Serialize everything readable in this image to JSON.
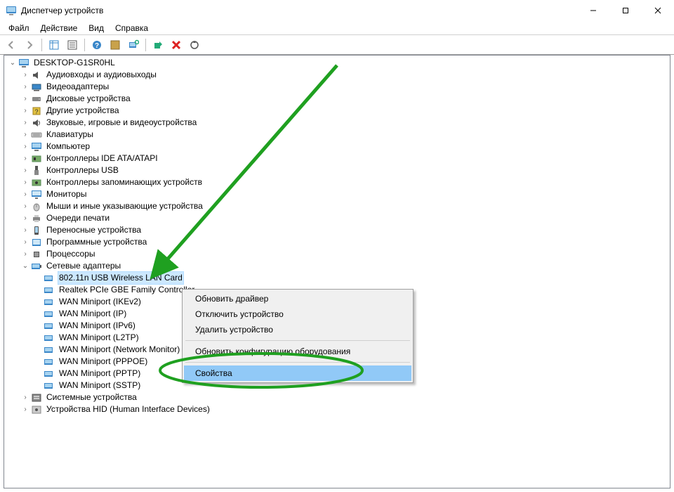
{
  "window": {
    "title": "Диспетчер устройств"
  },
  "menu": {
    "file": "Файл",
    "action": "Действие",
    "view": "Вид",
    "help": "Справка"
  },
  "root": "DESKTOP-G1SR0HL",
  "categories": [
    "Аудиовходы и аудиовыходы",
    "Видеоадаптеры",
    "Дисковые устройства",
    "Другие устройства",
    "Звуковые, игровые и видеоустройства",
    "Клавиатуры",
    "Компьютер",
    "Контроллеры IDE ATA/ATAPI",
    "Контроллеры USB",
    "Контроллеры запоминающих устройств",
    "Мониторы",
    "Мыши и иные указывающие устройства",
    "Очереди печати",
    "Переносные устройства",
    "Программные устройства",
    "Процессоры",
    "Сетевые адаптеры",
    "Системные устройства",
    "Устройства HID (Human Interface Devices)"
  ],
  "network_devices": [
    "802.11n USB Wireless LAN Card",
    "Realtek PCIe GBE Family Controller",
    "WAN Miniport (IKEv2)",
    "WAN Miniport (IP)",
    "WAN Miniport (IPv6)",
    "WAN Miniport (L2TP)",
    "WAN Miniport (Network Monitor)",
    "WAN Miniport (PPPOE)",
    "WAN Miniport (PPTP)",
    "WAN Miniport (SSTP)"
  ],
  "context_menu": {
    "update_driver": "Обновить драйвер",
    "disable_device": "Отключить устройство",
    "uninstall_device": "Удалить устройство",
    "scan_hw": "Обновить конфигурацию оборудования",
    "properties": "Свойства"
  }
}
